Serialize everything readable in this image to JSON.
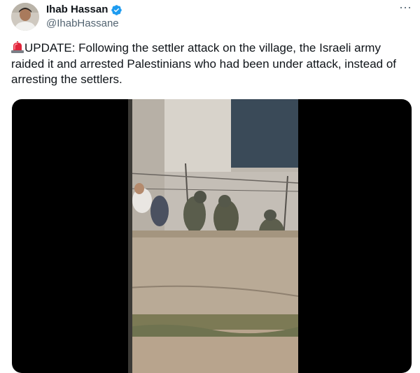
{
  "author": {
    "display_name": "Ihab Hassan",
    "handle": "@IhabHassane",
    "verified": true,
    "verified_color": "#1d9bf0"
  },
  "menu": {
    "more_label": "···"
  },
  "tweet": {
    "prefix_icon": "siren-icon",
    "text": "UPDATE: Following the settler attack on the village, the Israeli army raided it and arrested Palestinians who had been under attack, instead of arresting the settlers."
  },
  "media": {
    "type": "video",
    "description_icon": "video-frame"
  },
  "colors": {
    "text_primary": "#0f1419",
    "text_secondary": "#536471",
    "media_background": "#000000"
  }
}
